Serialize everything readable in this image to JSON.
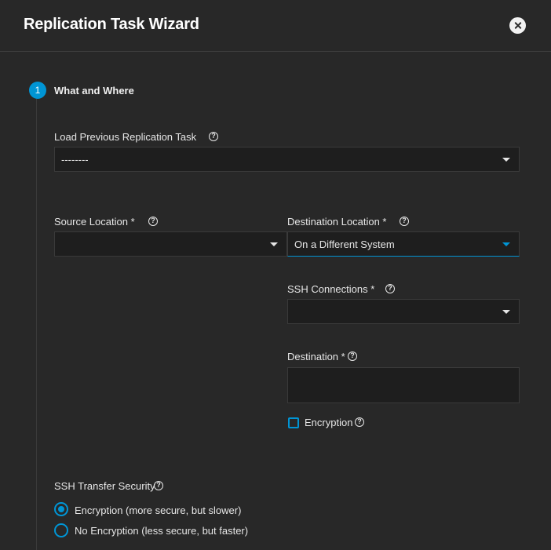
{
  "dialog": {
    "title": "Replication Task Wizard",
    "close_icon": "close-icon"
  },
  "step": {
    "number": "1",
    "label": "What and Where"
  },
  "load_previous": {
    "label": "Load Previous Replication Task",
    "value": "--------"
  },
  "source_location": {
    "label": "Source Location *",
    "value": ""
  },
  "destination_location": {
    "label": "Destination Location *",
    "value": "On a Different System"
  },
  "ssh_connections": {
    "label": "SSH Connections *",
    "value": ""
  },
  "destination": {
    "label": "Destination *",
    "value": ""
  },
  "encryption": {
    "label": "Encryption",
    "checked": false
  },
  "ssh_transfer_security": {
    "label": "SSH Transfer Security",
    "options": [
      {
        "label": "Encryption (more secure, but slower)",
        "checked": true
      },
      {
        "label": "No Encryption (less secure, but faster)",
        "checked": false
      }
    ]
  },
  "colors": {
    "accent": "#0095d5",
    "background": "#282828",
    "field_background": "#1e1e1e"
  }
}
